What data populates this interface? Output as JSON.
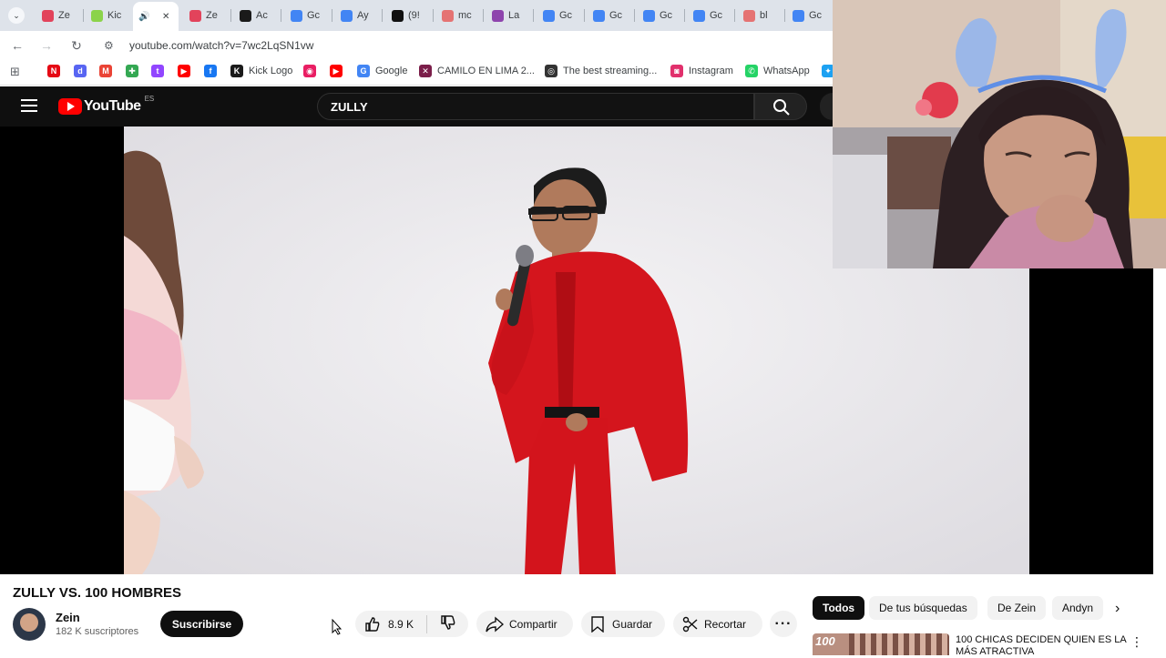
{
  "browser": {
    "tabs": [
      {
        "label": "Ze",
        "icon": "zein-favicon",
        "color": "#e2435b"
      },
      {
        "label": "Kic",
        "icon": "kick-favicon",
        "color": "#8bd34a"
      },
      {
        "label": "",
        "icon": "speaker-icon",
        "color": "#5f6368",
        "active": true
      },
      {
        "label": "Ze",
        "icon": "zein-favicon",
        "color": "#e2435b"
      },
      {
        "label": "Ac",
        "icon": "kick-favicon",
        "color": "#1a1a1a"
      },
      {
        "label": "Gc",
        "icon": "google-favicon",
        "color": "#4285f4"
      },
      {
        "label": "Ay",
        "icon": "google-favicon",
        "color": "#4285f4"
      },
      {
        "label": "(9!",
        "icon": "tiktok-favicon",
        "color": "#111111"
      },
      {
        "label": "mc",
        "icon": "shield-favicon",
        "color": "#e57373"
      },
      {
        "label": "La",
        "icon": "kick-favicon",
        "color": "#8e44ad"
      },
      {
        "label": "Gc",
        "icon": "google-favicon",
        "color": "#4285f4"
      },
      {
        "label": "Gc",
        "icon": "google-favicon",
        "color": "#4285f4"
      },
      {
        "label": "Gc",
        "icon": "google-favicon",
        "color": "#4285f4"
      },
      {
        "label": "Gc",
        "icon": "google-favicon",
        "color": "#4285f4"
      },
      {
        "label": "bl",
        "icon": "shield-favicon",
        "color": "#e57373"
      },
      {
        "label": "Gc",
        "icon": "google-favicon",
        "color": "#4285f4"
      }
    ],
    "url": "youtube.com/watch?v=7wc2LqSN1vw",
    "bookmarks": [
      {
        "label": "",
        "icon": "netflix-icon",
        "color": "#e50914",
        "glyph": "N"
      },
      {
        "label": "",
        "icon": "discord-icon",
        "color": "#5865f2",
        "glyph": "d"
      },
      {
        "label": "",
        "icon": "gmail-icon",
        "color": "#ea4335",
        "glyph": "M"
      },
      {
        "label": "",
        "icon": "puzzle-icon",
        "color": "#34a853",
        "glyph": "✚"
      },
      {
        "label": "",
        "icon": "twitch-icon",
        "color": "#9146ff",
        "glyph": "t"
      },
      {
        "label": "",
        "icon": "youtube-icon",
        "color": "#ff0000",
        "glyph": "▶"
      },
      {
        "label": "",
        "icon": "facebook-icon",
        "color": "#1877f2",
        "glyph": "f"
      },
      {
        "label": "Kick Logo",
        "icon": "kick-icon",
        "color": "#1a1a1a",
        "glyph": "K"
      },
      {
        "label": "",
        "icon": "music-icon",
        "color": "#e91e63",
        "glyph": "◉"
      },
      {
        "label": "",
        "icon": "youtube-icon",
        "color": "#ff0000",
        "glyph": "▶"
      },
      {
        "label": "Google",
        "icon": "google-icon",
        "color": "#4285f4",
        "glyph": "G"
      },
      {
        "label": "CAMILO EN LIMA 2...",
        "icon": "x-icon",
        "color": "#7b1e4a",
        "glyph": "✕"
      },
      {
        "label": "The best streaming...",
        "icon": "obs-icon",
        "color": "#333333",
        "glyph": "◎"
      },
      {
        "label": "Instagram",
        "icon": "instagram-icon",
        "color": "#e1306c",
        "glyph": "◙"
      },
      {
        "label": "WhatsApp",
        "icon": "whatsapp-icon",
        "color": "#25d366",
        "glyph": "✆"
      },
      {
        "label": "",
        "icon": "twitter-icon",
        "color": "#1da1f2",
        "glyph": "✦"
      }
    ]
  },
  "youtube": {
    "logo_text": "YouTube",
    "region": "ES",
    "search_value": "ZULLY",
    "video_title": "ZULLY VS. 100 HOMBRES",
    "channel_name": "Zein",
    "subscribers": "182 K suscriptores",
    "subscribe_label": "Suscribirse",
    "likes": "8.9 K",
    "share_label": "Compartir",
    "save_label": "Guardar",
    "clip_label": "Recortar",
    "chips": [
      "Todos",
      "De tus búsquedas",
      "De Zein",
      "Andyn"
    ],
    "recommended": {
      "title": "100 CHICAS DECIDEN QUIEN ES LA MÁS ATRACTIVA",
      "thumb_text": "100"
    }
  }
}
